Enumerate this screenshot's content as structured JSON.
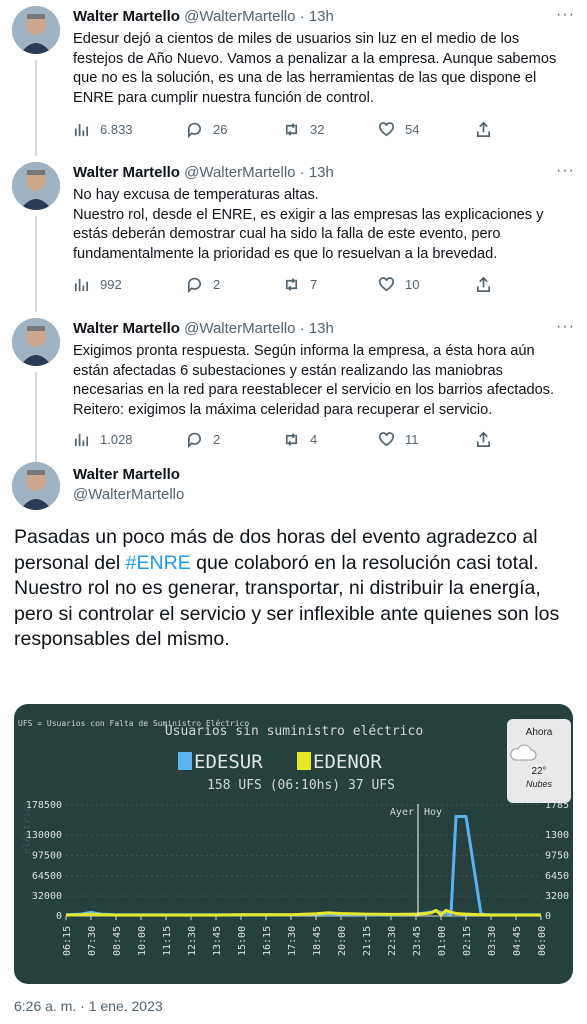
{
  "thread": [
    {
      "name": "Walter Martello",
      "handle": "@WalterMartello",
      "time": "13h",
      "lines": [
        "Edesur dejó a cientos de miles de usuarios sin luz en el medio de los",
        "festejos de Año Nuevo. Vamos a penalizar a la empresa. Aunque sabemos",
        "que no es la solución, es una de las herramientas de las que dispone el",
        "ENRE para cumplir nuestra función de control."
      ],
      "views": "6.833",
      "replies": "26",
      "retweets": "32",
      "likes": "54"
    },
    {
      "name": "Walter Martello",
      "handle": "@WalterMartello",
      "time": "13h",
      "lines": [
        "No hay excusa de temperaturas altas.",
        "Nuestro rol, desde el ENRE, es exigir a las empresas las explicaciones y",
        "estás deberán demostrar cual ha sido la falla de este evento, pero",
        "fundamentalmente la prioridad es que lo resuelvan a la brevedad."
      ],
      "views": "992",
      "replies": "2",
      "retweets": "7",
      "likes": "10"
    },
    {
      "name": "Walter Martello",
      "handle": "@WalterMartello",
      "time": "13h",
      "lines": [
        "Exigimos pronta respuesta. Según informa la empresa, a ésta hora aún",
        "están afectadas 6 subestaciones y están realizando las maniobras",
        "necesarias en la red para reestablecer el servicio en los barrios afectados.",
        "Reitero: exigimos la máxima celeridad para  recuperar el servicio."
      ],
      "views": "1.028",
      "replies": "2",
      "retweets": "4",
      "likes": "11"
    }
  ],
  "main_tweet": {
    "name": "Walter Martello",
    "handle": "@WalterMartello",
    "text_before": "Pasadas un poco más de dos horas del evento agradezco al personal del ",
    "hashtag": "#ENRE",
    "text_after": " que colaboró en la resolución casi total.",
    "text_second": "Nuestro rol no es generar, transportar, ni distribuir la energía, pero si controlar el servicio y ser inflexible ante quienes son los responsables del mismo.",
    "timestamp": "6:26 a. m. · 1 ene. 2023"
  },
  "weather": {
    "label": "Ahora",
    "temp": "22°",
    "condition": "Nubes"
  },
  "colors": {
    "edesur": "#59b3f0",
    "edenor": "#e6e62a",
    "chart_bg": "#26403e",
    "link": "#1d9bf0"
  },
  "chart_data": {
    "type": "line",
    "top_note": "UFS = Usuarios con Falta de Suministro Eléctrico",
    "title": "Usuarios sin suministro eléctrico",
    "legend": [
      "EDESUR",
      "EDENOR"
    ],
    "subtitle": "158 UFS (06:10hs) 37 UFS",
    "ylabel": "eléctrico",
    "yticks": [
      "178500",
      "130000",
      "97500",
      "64500",
      "32000",
      "0"
    ],
    "yticks_right": [
      "1785",
      "1300",
      "9750",
      "6450",
      "3200",
      "0"
    ],
    "ytick_values": [
      178500,
      130000,
      97500,
      64500,
      32000,
      0
    ],
    "ylim": [
      0,
      178500
    ],
    "xticks": [
      "06:15",
      "07:30",
      "08:45",
      "10:00",
      "11:15",
      "12:30",
      "13:45",
      "15:00",
      "16:15",
      "17:30",
      "18:45",
      "20:00",
      "21:15",
      "22:30",
      "23:45",
      "01:00",
      "02:15",
      "03:30",
      "04:45",
      "06:00"
    ],
    "annotations": [
      "Ayer",
      "Hoy"
    ],
    "divider_at": "00:30",
    "x_index": [
      0,
      0.6,
      1.0,
      1.4,
      2,
      3,
      4,
      5,
      6,
      7,
      8,
      9,
      10,
      10.5,
      11,
      12,
      13,
      14,
      14.4,
      14.6,
      14.8,
      15,
      15.2,
      15.4,
      15.6,
      16,
      16.6,
      17,
      18,
      19
    ],
    "series": [
      {
        "name": "EDESUR",
        "values": [
          2000,
          3000,
          6000,
          3000,
          2000,
          2000,
          2000,
          2000,
          2000,
          2000,
          2000,
          2000,
          3000,
          4000,
          3000,
          2000,
          2000,
          3000,
          5000,
          6000,
          8000,
          6000,
          4000,
          3000,
          160000,
          160000,
          3000,
          2000,
          2000,
          2000
        ]
      },
      {
        "name": "EDENOR",
        "values": [
          1500,
          2000,
          3000,
          2000,
          1500,
          1500,
          1500,
          1500,
          1500,
          2000,
          2000,
          2000,
          3500,
          5000,
          4000,
          3000,
          2500,
          3000,
          4000,
          5000,
          9000,
          2000,
          9000,
          6000,
          4000,
          3000,
          2000,
          1500,
          1500,
          1500
        ]
      }
    ]
  }
}
